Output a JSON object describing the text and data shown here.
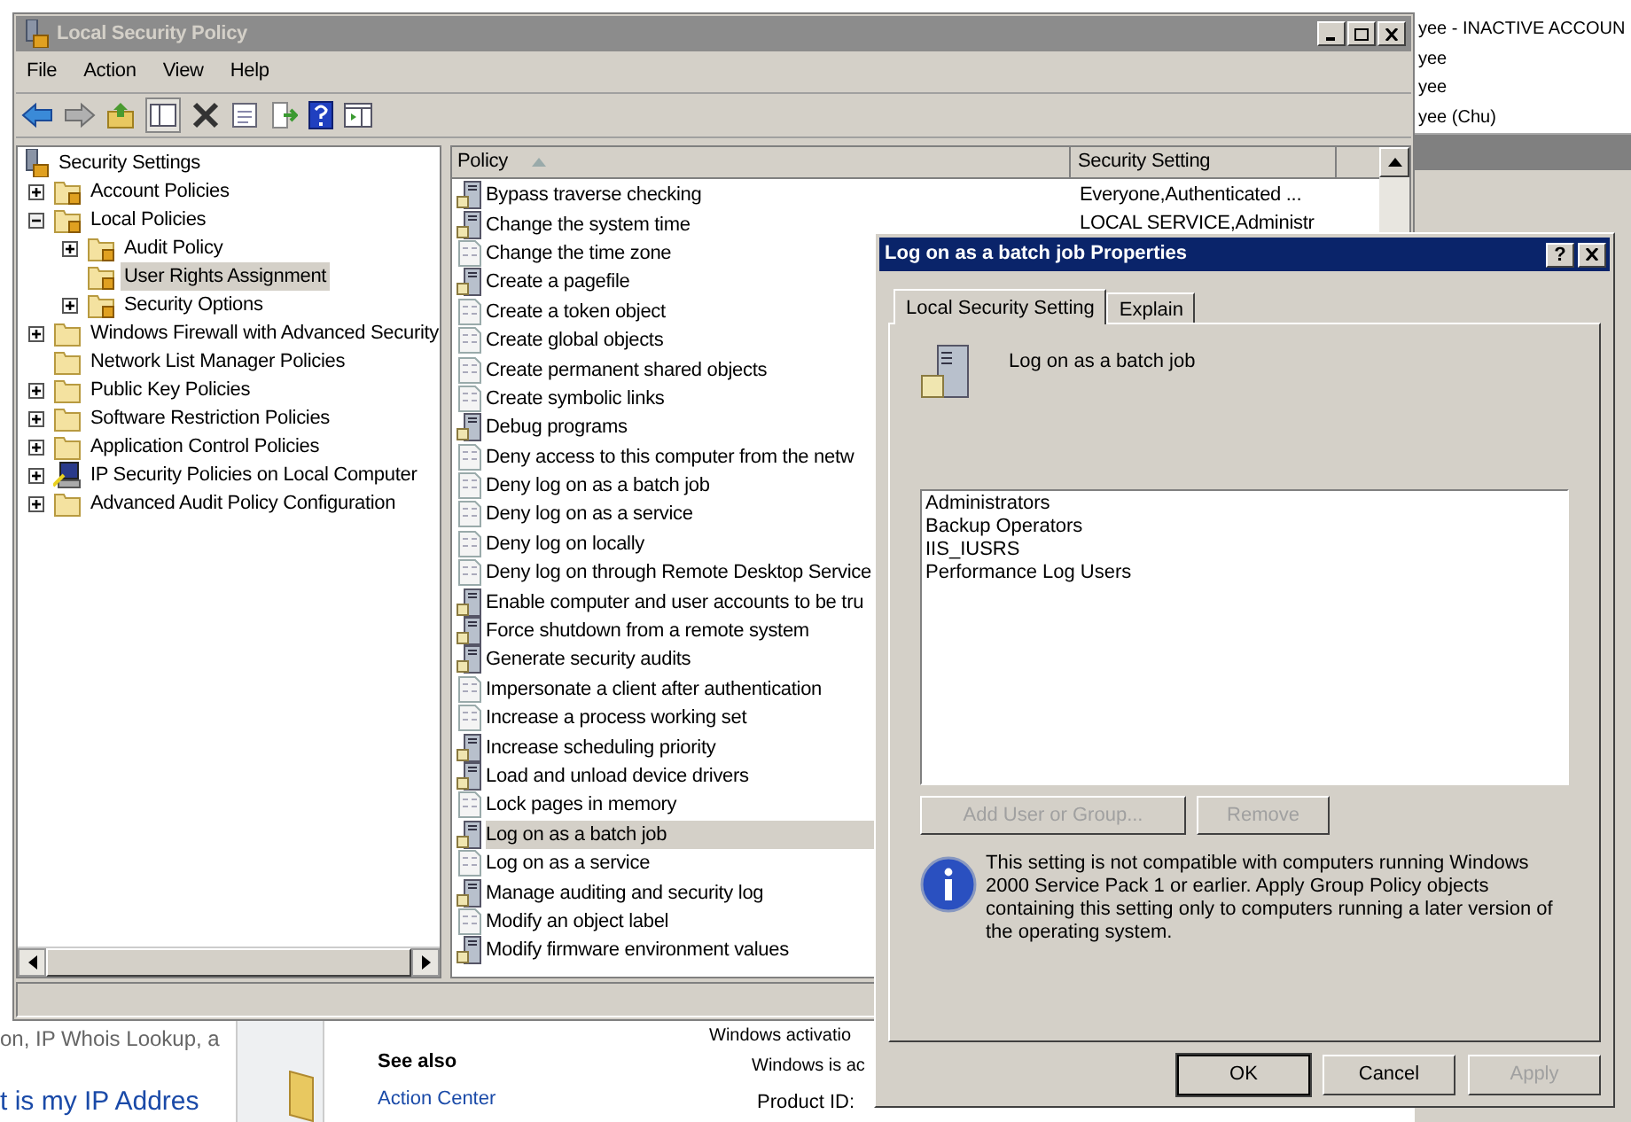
{
  "background": {
    "account_list": [
      "yee - INACTIVE ACCOUN",
      "yee",
      "yee",
      "yee (Chu)"
    ],
    "snippet": "on, IP Whois Lookup, a",
    "heading": "t is my IP Addres",
    "see_also": {
      "title": "See also",
      "links": [
        "Action Center"
      ]
    },
    "activation": {
      "heading": "Windows activatio",
      "status": "Windows is ac",
      "product_id_label": "Product ID:"
    }
  },
  "window": {
    "title": "Local Security Policy",
    "menu": [
      "File",
      "Action",
      "View",
      "Help"
    ],
    "tree": [
      {
        "label": "Security Settings",
        "kind": "root",
        "selected": false,
        "children": [
          {
            "label": "Account Policies",
            "kind": "locked-folder",
            "expandable": true,
            "expanded": false,
            "selected": false
          },
          {
            "label": "Local Policies",
            "kind": "locked-folder",
            "expandable": true,
            "expanded": true,
            "selected": false,
            "children": [
              {
                "label": "Audit Policy",
                "kind": "locked-folder",
                "expandable": true,
                "expanded": false,
                "selected": false
              },
              {
                "label": "User Rights Assignment",
                "kind": "locked-folder",
                "expandable": false,
                "selected": true
              },
              {
                "label": "Security Options",
                "kind": "locked-folder",
                "expandable": true,
                "expanded": false,
                "selected": false
              }
            ]
          },
          {
            "label": "Windows Firewall with Advanced Security",
            "kind": "folder",
            "expandable": true,
            "expanded": false,
            "selected": false
          },
          {
            "label": "Network List Manager Policies",
            "kind": "folder",
            "expandable": false,
            "selected": false
          },
          {
            "label": "Public Key Policies",
            "kind": "folder",
            "expandable": true,
            "expanded": false,
            "selected": false
          },
          {
            "label": "Software Restriction Policies",
            "kind": "folder",
            "expandable": true,
            "expanded": false,
            "selected": false
          },
          {
            "label": "Application Control Policies",
            "kind": "folder",
            "expandable": true,
            "expanded": false,
            "selected": false
          },
          {
            "label": "IP Security Policies on Local Computer",
            "kind": "ip-security",
            "expandable": true,
            "expanded": false,
            "selected": false
          },
          {
            "label": "Advanced Audit Policy Configuration",
            "kind": "folder",
            "expandable": true,
            "expanded": false,
            "selected": false
          }
        ]
      }
    ],
    "list": {
      "columns": [
        "Policy",
        "Security Setting"
      ],
      "rows": [
        {
          "policy": "Bypass traverse checking",
          "setting": "Everyone,Authenticated ...",
          "kind": "defined",
          "selected": false
        },
        {
          "policy": "Change the system time",
          "setting": "LOCAL SERVICE,Administr",
          "kind": "defined",
          "selected": false
        },
        {
          "policy": "Change the time zone",
          "kind": "undefined",
          "selected": false
        },
        {
          "policy": "Create a pagefile",
          "kind": "defined",
          "selected": false
        },
        {
          "policy": "Create a token object",
          "kind": "undefined",
          "selected": false
        },
        {
          "policy": "Create global objects",
          "kind": "undefined",
          "selected": false
        },
        {
          "policy": "Create permanent shared objects",
          "kind": "undefined",
          "selected": false
        },
        {
          "policy": "Create symbolic links",
          "kind": "undefined",
          "selected": false
        },
        {
          "policy": "Debug programs",
          "kind": "defined",
          "selected": false
        },
        {
          "policy": "Deny access to this computer from the netw",
          "kind": "undefined",
          "selected": false
        },
        {
          "policy": "Deny log on as a batch job",
          "kind": "undefined",
          "selected": false
        },
        {
          "policy": "Deny log on as a service",
          "kind": "undefined",
          "selected": false
        },
        {
          "policy": "Deny log on locally",
          "kind": "undefined",
          "selected": false
        },
        {
          "policy": "Deny log on through Remote Desktop Service",
          "kind": "undefined",
          "selected": false
        },
        {
          "policy": "Enable computer and user accounts to be tru",
          "kind": "defined",
          "selected": false
        },
        {
          "policy": "Force shutdown from a remote system",
          "kind": "defined",
          "selected": false
        },
        {
          "policy": "Generate security audits",
          "kind": "defined",
          "selected": false
        },
        {
          "policy": "Impersonate a client after authentication",
          "kind": "undefined",
          "selected": false
        },
        {
          "policy": "Increase a process working set",
          "kind": "undefined",
          "selected": false
        },
        {
          "policy": "Increase scheduling priority",
          "kind": "defined",
          "selected": false
        },
        {
          "policy": "Load and unload device drivers",
          "kind": "defined",
          "selected": false
        },
        {
          "policy": "Lock pages in memory",
          "kind": "undefined",
          "selected": false
        },
        {
          "policy": "Log on as a batch job",
          "kind": "defined",
          "selected": true
        },
        {
          "policy": "Log on as a service",
          "kind": "undefined",
          "selected": false
        },
        {
          "policy": "Manage auditing and security log",
          "kind": "defined",
          "selected": false
        },
        {
          "policy": "Modify an object label",
          "kind": "undefined",
          "selected": false
        },
        {
          "policy": "Modify firmware environment values",
          "kind": "defined",
          "selected": false
        }
      ]
    }
  },
  "dialog": {
    "title": "Log on as a batch job Properties",
    "help_button": "?",
    "tabs": [
      {
        "label": "Local Security Setting",
        "selected": true
      },
      {
        "label": "Explain",
        "selected": false
      }
    ],
    "policy_name": "Log on as a batch job",
    "members": [
      "Administrators",
      "Backup Operators",
      "IIS_IUSRS",
      "Performance Log Users"
    ],
    "member_buttons": [
      {
        "label": "Add User or Group...",
        "disabled": true
      },
      {
        "label": "Remove",
        "disabled": true
      }
    ],
    "info": "This setting is not compatible with computers running Windows 2000 Service Pack 1 or earlier.  Apply Group Policy objects containing this setting only to computers running a later version of the operating system.",
    "buttons": [
      {
        "label": "OK",
        "disabled": false,
        "default": true
      },
      {
        "label": "Cancel",
        "disabled": false,
        "default": false
      },
      {
        "label": "Apply",
        "disabled": true,
        "default": false
      }
    ]
  }
}
